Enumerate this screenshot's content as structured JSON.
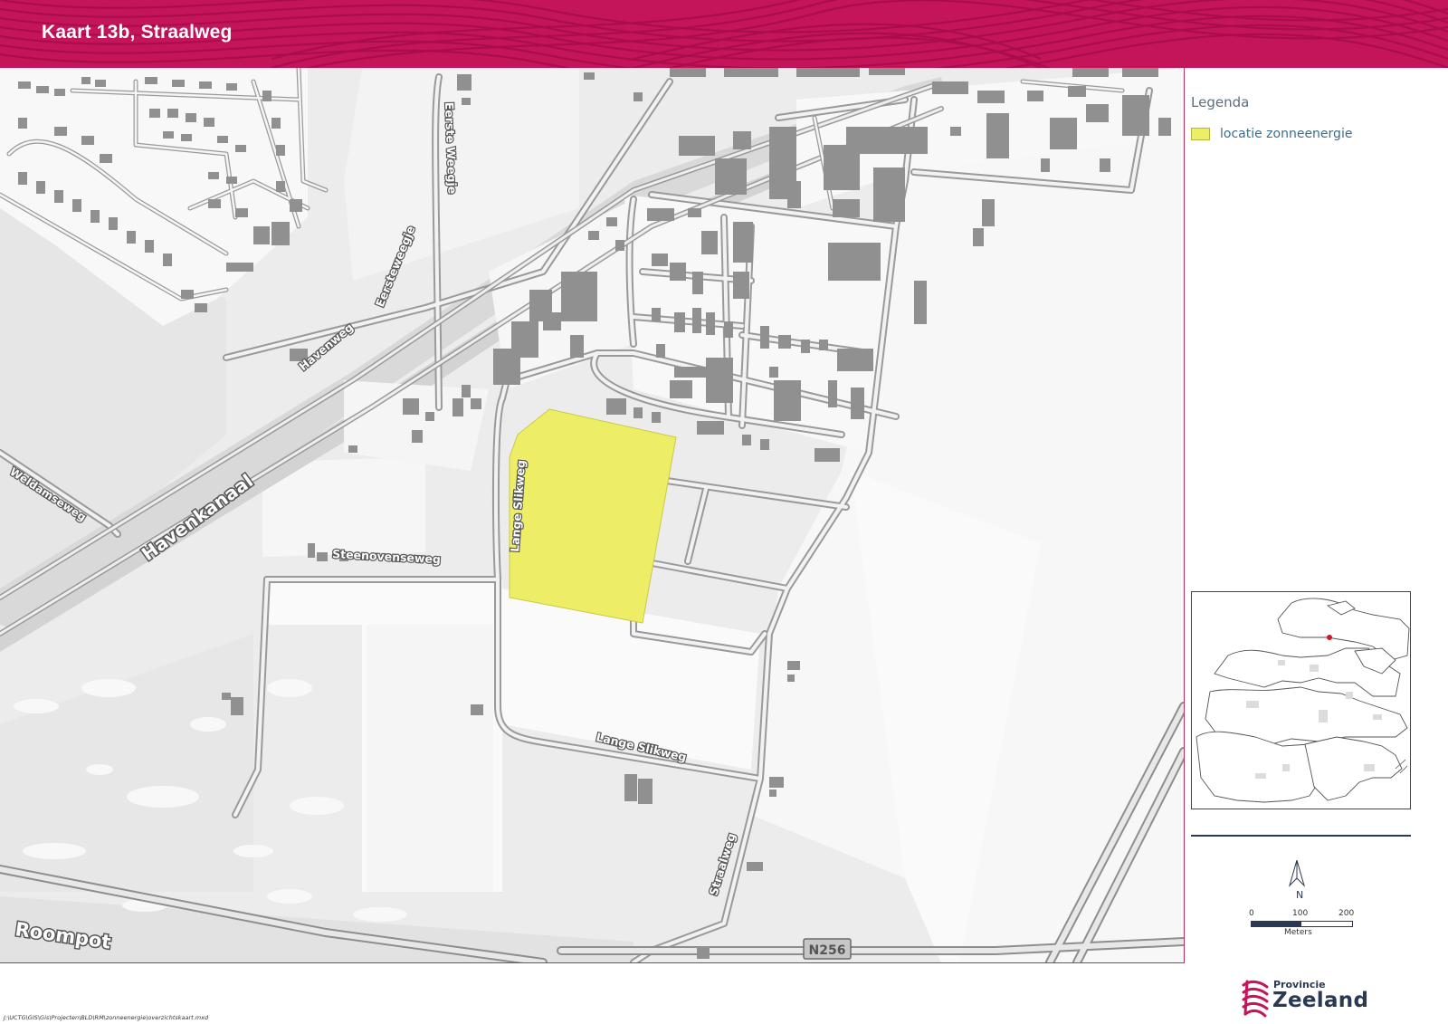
{
  "header": {
    "title": "Kaart 13b, Straalweg"
  },
  "map": {
    "road_labels": {
      "eerste_weegje": "Eerste Weegje",
      "eersteweegje": "Eersteweegje",
      "havenweg": "Havenweg",
      "havenkanaal": "Havenkanaal",
      "weldamseweg": "Weldamseweg",
      "steenovenseweg": "Steenovenseweg",
      "lange_slikweg_vertical": "Lange Slikweg",
      "lange_slikweg_horizontal": "Lange Slikweg",
      "straalweg": "Straalweg",
      "roompot": "Roompot",
      "n256": "N256"
    },
    "highlight_color": "#eeee66"
  },
  "legend": {
    "title": "Legenda",
    "items": [
      {
        "label": "locatie zonneenergie",
        "color": "#eeee66"
      }
    ]
  },
  "north_arrow": {
    "label": "N"
  },
  "scale_bar": {
    "ticks": [
      "0",
      "100",
      "200"
    ],
    "unit": "Meters"
  },
  "footer": {
    "file_path": "J:\\UCTG\\GIS\\Gis\\Projecten\\BLD\\RM\\zonneenergie\\overzichtskaart.mxd",
    "logo_line1": "Provincie",
    "logo_line2": "Zeeland"
  },
  "colors": {
    "header_bg": "#c4145a",
    "brand_text": "#2a3a55"
  }
}
